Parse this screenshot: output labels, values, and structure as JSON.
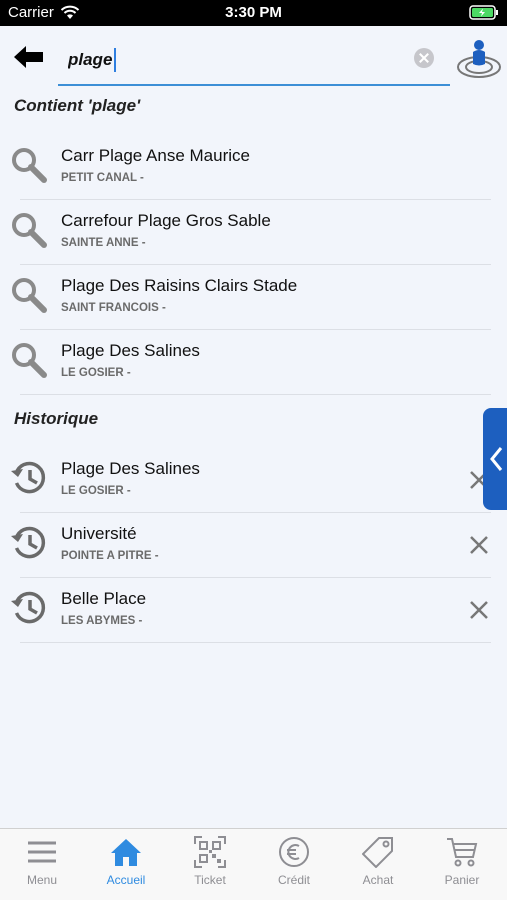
{
  "status_bar": {
    "carrier": "Carrier",
    "time": "3:30 PM"
  },
  "search": {
    "value": "plage"
  },
  "sections": [
    {
      "title": "Contient 'plage'",
      "kind": "search-icon",
      "items": [
        {
          "name": "Carr Plage Anse Maurice",
          "sub": "PETIT CANAL -"
        },
        {
          "name": "Carrefour Plage Gros Sable",
          "sub": "SAINTE ANNE -"
        },
        {
          "name": "Plage Des Raisins Clairs Stade",
          "sub": "SAINT FRANCOIS -"
        },
        {
          "name": "Plage Des Salines",
          "sub": "LE GOSIER -"
        }
      ]
    },
    {
      "title": "Historique",
      "kind": "history-icon",
      "items": [
        {
          "name": "Plage Des Salines",
          "sub": "LE GOSIER -"
        },
        {
          "name": "Université",
          "sub": "POINTE A PITRE -"
        },
        {
          "name": "Belle Place",
          "sub": "LES ABYMES -"
        }
      ]
    }
  ],
  "tabbar": {
    "active": "Accueil",
    "accent": "#2f8be0",
    "items": [
      {
        "label": "Menu",
        "icon": "menu-icon"
      },
      {
        "label": "Accueil",
        "icon": "home-icon"
      },
      {
        "label": "Ticket",
        "icon": "qr-code-icon"
      },
      {
        "label": "Crédit",
        "icon": "euro-icon"
      },
      {
        "label": "Achat",
        "icon": "tag-icon"
      },
      {
        "label": "Panier",
        "icon": "cart-icon"
      }
    ]
  }
}
